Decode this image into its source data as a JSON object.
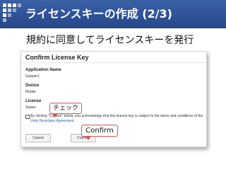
{
  "slide": {
    "title": "ライセンスキーの作成 (2/3)",
    "subtitle": "規約に同意してライセンスキーを発行"
  },
  "panel": {
    "title": "Confirm License Key",
    "application": {
      "label": "Application Name",
      "value": "Sample1"
    },
    "device": {
      "label": "Device",
      "value": "Mobile"
    },
    "license": {
      "label": "License",
      "value": "Starter"
    },
    "agreement": {
      "text": "By clicking \"Confirm\" below, you acknowledge that this license key is subject to the terms and conditions of the",
      "link": "Unity Developer Agreement",
      "end": "."
    },
    "buttons": {
      "cancel": "Cancel",
      "confirm": "Confirm"
    }
  },
  "callouts": {
    "check": "チェック",
    "confirm": "Confirm"
  },
  "colors": {
    "header": "#2f559b",
    "callout_border": "#d9534f",
    "link": "#1a5fb4"
  }
}
